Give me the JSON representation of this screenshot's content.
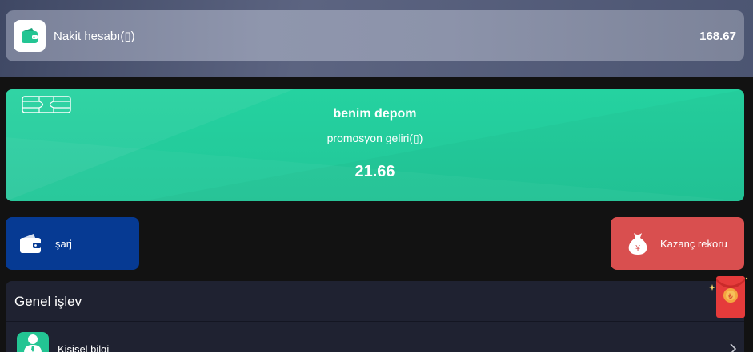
{
  "cash_account": {
    "label": "Nakit hesabı(▯)",
    "value": "168.67",
    "icon": "wallet-icon"
  },
  "depot": {
    "title": "benim depom",
    "subtitle": "promosyon geliri(▯)",
    "value": "21.66",
    "icon": "card-chip-icon"
  },
  "actions": {
    "charge_label": "şarj",
    "earnings_label": "Kazanç rekoru"
  },
  "general": {
    "title": "Genel işlev",
    "personal_info_label": "Kişisel bilgi"
  },
  "colors": {
    "accent_green": "#25d2a0",
    "charge_blue": "#063a93",
    "earnings_red": "#d94f4f",
    "panel_dark": "#1f2231"
  }
}
